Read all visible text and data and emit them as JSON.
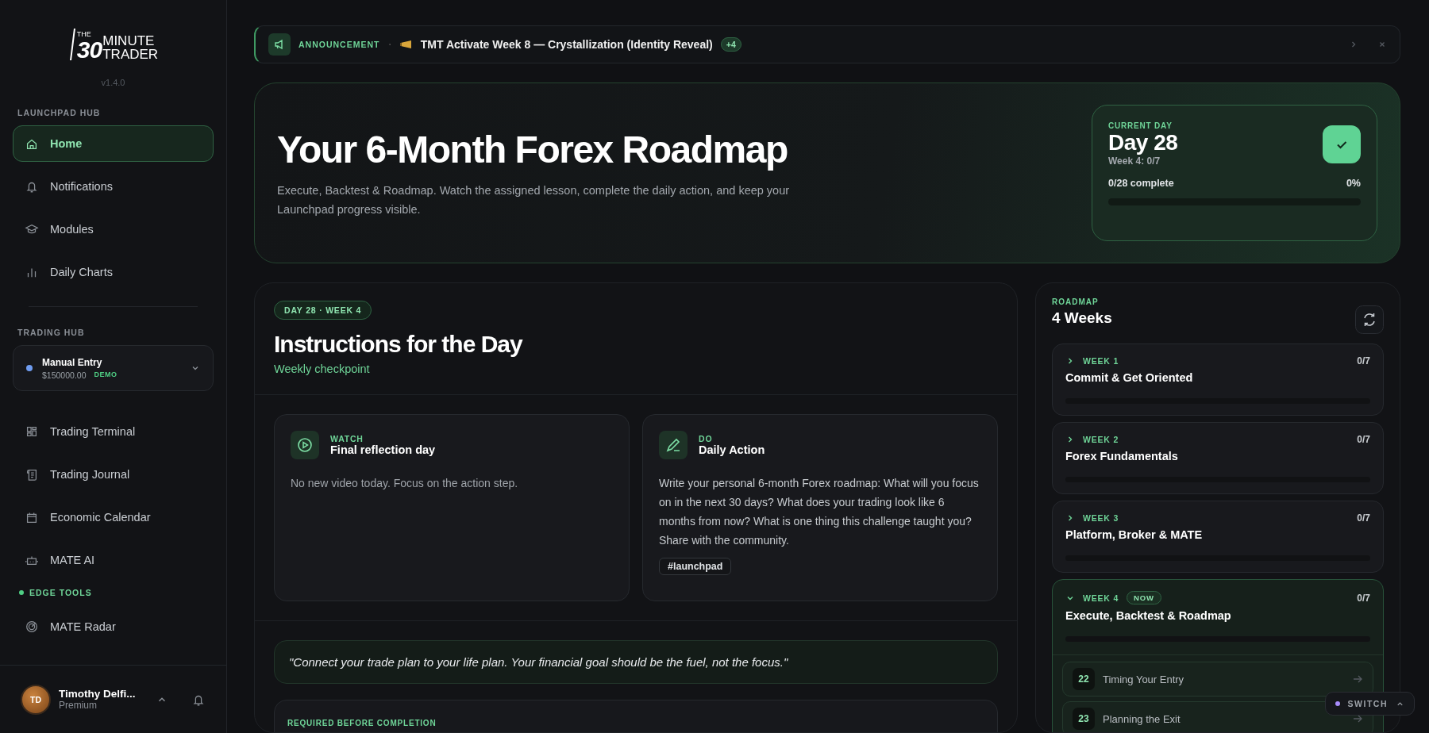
{
  "sidebar": {
    "logo": {
      "small": "THE",
      "number": "30",
      "line1": "MINUTE",
      "line2": "TRADER"
    },
    "version": "v1.4.0",
    "launchpad": {
      "title": "LAUNCHPAD HUB",
      "items": [
        {
          "label": "Home",
          "selected": true
        },
        {
          "label": "Notifications",
          "selected": false
        },
        {
          "label": "Modules",
          "selected": false
        },
        {
          "label": "Daily Charts",
          "selected": false
        }
      ]
    },
    "trading": {
      "title": "TRADING HUB",
      "account": {
        "name": "Manual Entry",
        "balance": "$150000.00",
        "badge": "DEMO",
        "color": "#6f9cf0"
      },
      "items": [
        {
          "label": "Trading Terminal",
          "selected": false
        },
        {
          "label": "Trading Journal",
          "selected": false
        },
        {
          "label": "Economic Calendar",
          "selected": false
        },
        {
          "label": "MATE AI",
          "selected": false
        }
      ]
    },
    "edge": {
      "title": "EDGE TOOLS",
      "items": [
        {
          "label": "MATE Radar",
          "selected": false
        }
      ]
    },
    "user": {
      "initials": "TD",
      "name": "Timothy Delfi...",
      "plan": "Premium"
    }
  },
  "announcement": {
    "label": "ANNOUNCEMENT",
    "separator": "·",
    "text": "TMT Activate Week 8 — Crystallization (Identity Reveal)",
    "count": "+4"
  },
  "hero": {
    "title": "Your 6-Month Forex Roadmap",
    "subtitle": "Execute, Backtest & Roadmap. Watch the assigned lesson, complete the daily action, and keep your Launchpad progress visible.",
    "current_day": {
      "label": "CURRENT DAY",
      "day": "Day 28",
      "week": "Week 4: 0/7",
      "complete": "0/28 complete",
      "percent": "0%",
      "level": 0,
      "checked": true
    }
  },
  "instructions": {
    "badge": "DAY 28 · WEEK 4",
    "title": "Instructions for the Day",
    "subtitle": "Weekly checkpoint",
    "cards": [
      {
        "kind": "watch",
        "label": "WATCH",
        "title": "Final reflection day",
        "body": "No new video today. Focus on the action step."
      },
      {
        "kind": "do",
        "label": "DO",
        "title": "Daily Action",
        "body": "Write your personal 6-month Forex roadmap: What will you focus on in the next 30 days? What does your trading look like 6 months from now? What is one thing this challenge taught you? Share with the community.",
        "tag": "#launchpad"
      }
    ],
    "quote": "\"Connect your trade plan to your life plan. Your financial goal should be the fuel, not the focus.\"",
    "required": "REQUIRED BEFORE COMPLETION"
  },
  "roadmap": {
    "label": "ROADMAP",
    "title": "4 Weeks",
    "weeks": [
      {
        "week": "WEEK 1",
        "title": "Commit & Get Oriented",
        "count": "0/7",
        "level": 0,
        "expanded": false
      },
      {
        "week": "WEEK 2",
        "title": "Forex Fundamentals",
        "count": "0/7",
        "level": 0,
        "expanded": false
      },
      {
        "week": "WEEK 3",
        "title": "Platform, Broker & MATE",
        "count": "0/7",
        "level": 0,
        "expanded": false
      },
      {
        "week": "WEEK 4",
        "badge": "NOW",
        "title": "Execute, Backtest & Roadmap",
        "count": "0/7",
        "level": 0,
        "expanded": true,
        "lessons": [
          {
            "number": "22",
            "title": "Timing Your Entry"
          },
          {
            "number": "23",
            "title": "Planning the Exit"
          }
        ]
      }
    ]
  },
  "switch": {
    "label": "SWITCH",
    "color": "#a78bfa"
  }
}
